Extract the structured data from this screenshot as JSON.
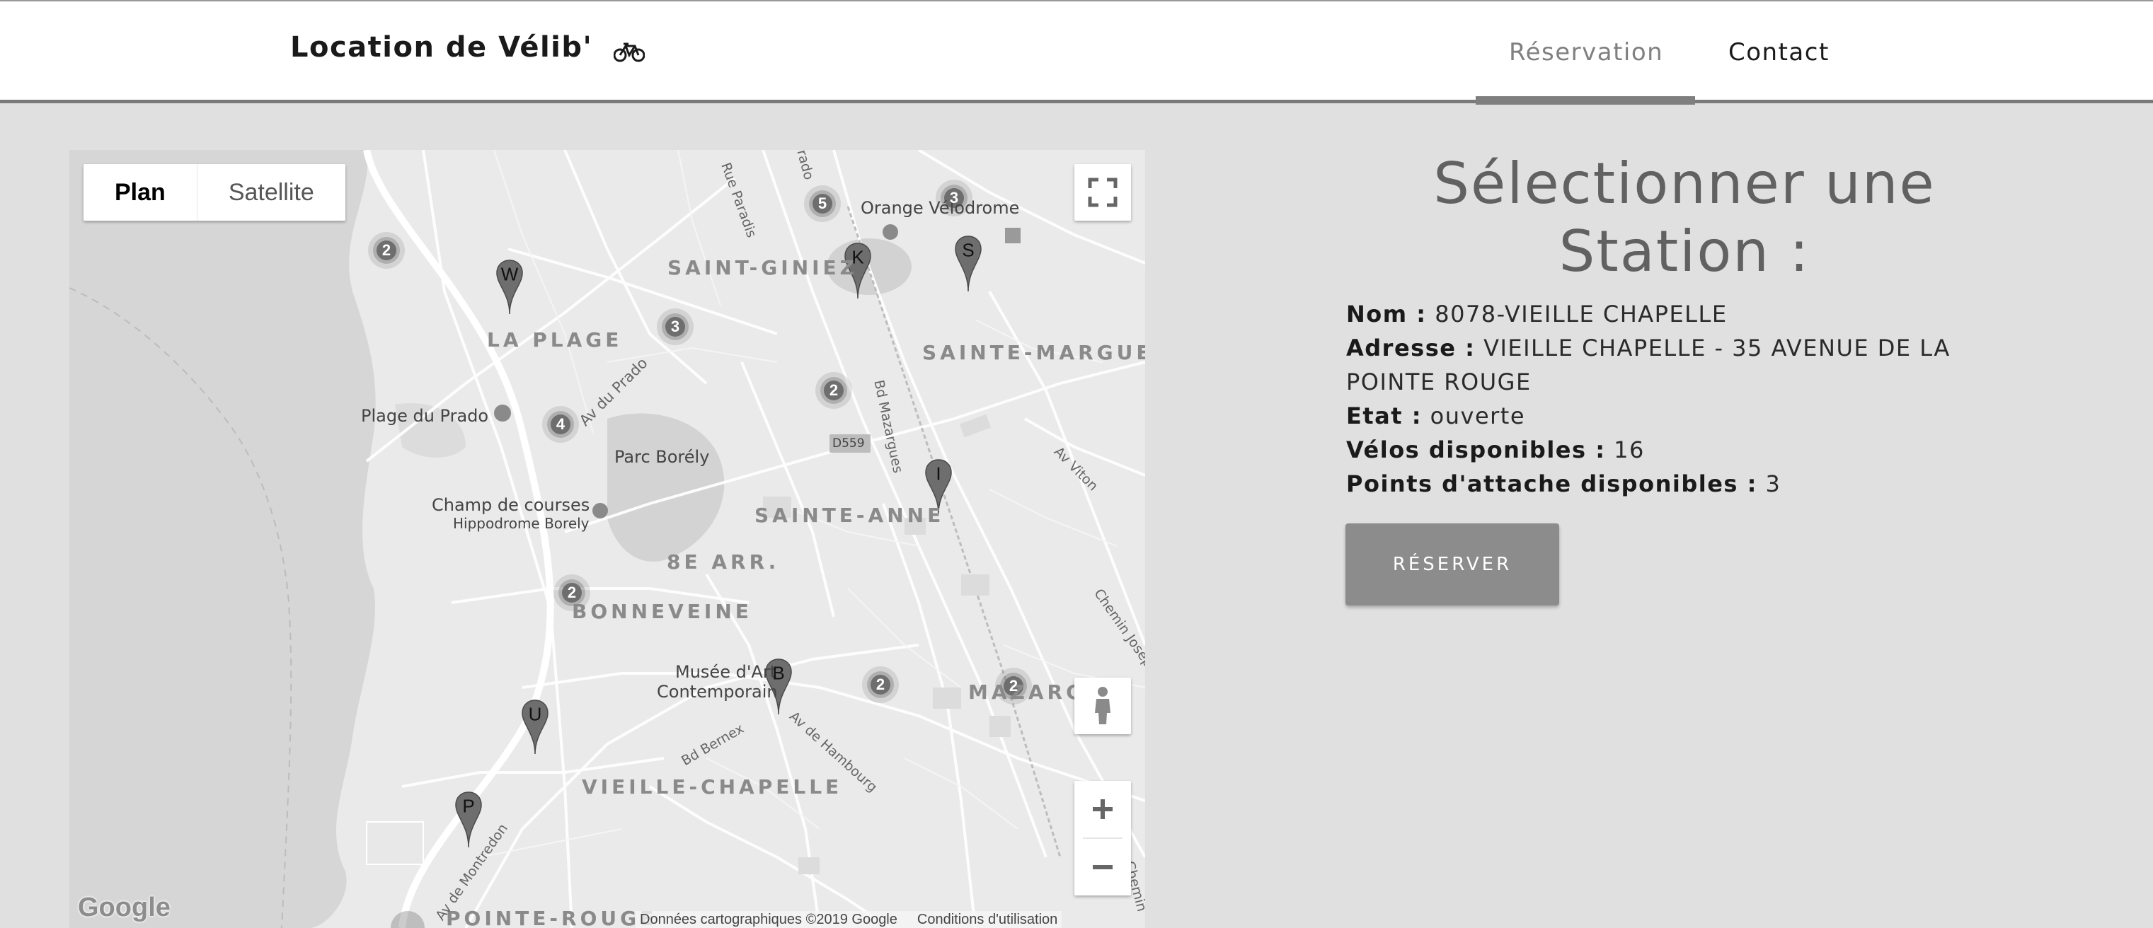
{
  "navbar": {
    "brand": "Location de Vélib'",
    "brand_icon": "bicycle-icon",
    "links": [
      {
        "label": "Réservation",
        "active": true
      },
      {
        "label": "Contact",
        "active": false
      }
    ]
  },
  "map": {
    "map_types": [
      "Plan",
      "Satellite"
    ],
    "selected_type": "Plan",
    "footer": {
      "attribution": "Données cartographiques ©2019 Google",
      "terms": "Conditions d'utilisation"
    },
    "logo": "Google",
    "districts": [
      "SAINT-GINIEZ",
      "LA PLAGE",
      "SAINTE-MARGUER",
      "SAINTE-ANNE",
      "8E ARR.",
      "BONNEVEINE",
      "VIEILLE-CHAPELLE",
      "POINTE-ROUGE",
      "MAZARG"
    ],
    "places": [
      "Orange Vélodrome",
      "Plage du Prado",
      "Parc Borély",
      "Champ de courses",
      "Hippodrome Borely",
      "Musée d'Art",
      "Contemporain"
    ],
    "roads": [
      "Rue Paradis",
      "Av du Prado",
      "Bd Mazargues",
      "Av Viton",
      "Chemin Joseph",
      "Av de Hambourg",
      "Bd Bernex",
      "Av de Montredon",
      "Chemin",
      "D559",
      "rado"
    ],
    "clusters": [
      "2",
      "5",
      "3",
      "3",
      "2",
      "4",
      "2",
      "2",
      "2"
    ],
    "markers": [
      "W",
      "K",
      "S",
      "I",
      "B",
      "U",
      "P"
    ]
  },
  "station": {
    "title": "Sélectionner une Station :",
    "name_label": "Nom :",
    "name_value": "8078-VIEILLE CHAPELLE",
    "address_label": "Adresse :",
    "address_value": "VIEILLE CHAPELLE - 35 AVENUE DE LA POINTE ROUGE",
    "status_label": "Etat :",
    "status_value": "ouverte",
    "bikes_label": "Vélos disponibles :",
    "bikes_value": "16",
    "stands_label": "Points d'attache disponibles :",
    "stands_value": "3",
    "reserve_button": "RÉSERVER"
  },
  "colors": {
    "background": "#e0e0e0",
    "navbar": "#ffffff",
    "button": "#8c8c8c",
    "marker": "#6e6e6e"
  }
}
